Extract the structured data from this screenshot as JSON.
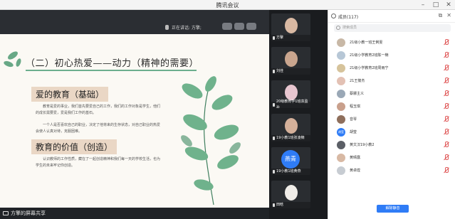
{
  "window": {
    "title": "腾讯会议"
  },
  "share": {
    "speaking_label": "正在讲话: 方擎;",
    "slide": {
      "title": "（二）初心热爱——动力（精神的需要）",
      "section1": "爱的教育（基础）",
      "para1": "教育是爱的事业，我们首先要爱自己的工作，我们的工作对象是学生，他们的成长需要爱，爱是我们工作的基石。",
      "para2": "一个人是否喜欢自己的职业，决定了他将来的生存状态，对自己职业的热爱会使人认真对待，克服困难。",
      "section2": "教育的价值（创造）",
      "para3": "认识教师的工作性质，藏在了一起创造精神和我们每一天的学校生活，也为学生的未来牢记你创造。"
    },
    "footer_label": "方擎的屏幕共享"
  },
  "thumbnails": [
    {
      "name": "方擎",
      "type": "photo"
    },
    {
      "name": "刘佳",
      "type": "photo"
    },
    {
      "name": "20级教育学1班袁盈盈",
      "type": "photo"
    },
    {
      "name": "19小教1班张凌楠",
      "type": "photo"
    },
    {
      "name": "19小教1班黄燕",
      "type": "text",
      "avatar_text": "燕青"
    },
    {
      "name": "田晗",
      "type": "photo"
    }
  ],
  "members": {
    "title": "成员(117)",
    "search_placeholder": "搜索成员",
    "unmute_button": "解除静音",
    "list": [
      {
        "name": "21级小教一班王俐雯"
      },
      {
        "name": "21级小学教育2班陈一楠"
      },
      {
        "name": "21级小学教育2班周雨宁"
      },
      {
        "name": "21王筱杰"
      },
      {
        "name": "蔡娜主义"
      },
      {
        "name": "程玉琪"
      },
      {
        "name": "音琴"
      },
      {
        "name": "胡莹",
        "avatar_text": "胡莹"
      },
      {
        "name": "黄文汉19小教2"
      },
      {
        "name": "黄晴露"
      },
      {
        "name": "黄卓煌"
      }
    ]
  },
  "colors": {
    "accent": "#2f7cf6",
    "mute": "#e05a5a",
    "slide_bg": "#fbf9f4",
    "heading_bg": "#ead7c5"
  }
}
